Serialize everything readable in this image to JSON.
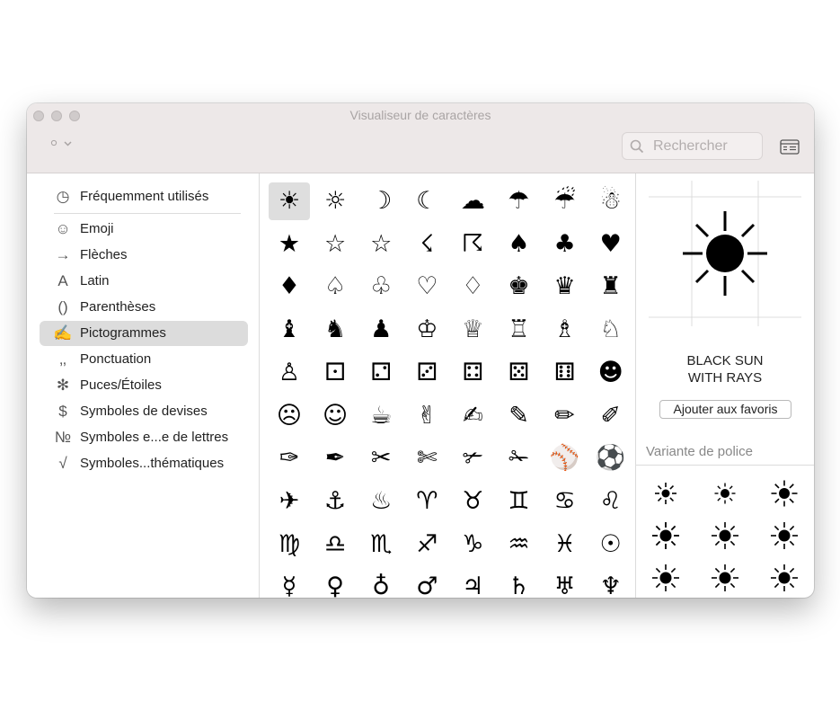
{
  "window": {
    "title": "Visualiseur de caractères"
  },
  "toolbar": {
    "view_icon": "circle-icon",
    "view_chevron": "chevron-down-icon",
    "search_placeholder": "Rechercher",
    "search_value": ""
  },
  "sidebar": {
    "items": [
      {
        "id": "frequent",
        "icon": "◷",
        "label": "Fréquemment utilisés"
      },
      {
        "id": "emoji",
        "icon": "☺",
        "label": "Emoji"
      },
      {
        "id": "arrows",
        "icon": "→",
        "label": "Flèches"
      },
      {
        "id": "latin",
        "icon": "A",
        "label": "Latin"
      },
      {
        "id": "brackets",
        "icon": "()",
        "label": "Parenthèses"
      },
      {
        "id": "pictographs",
        "icon": "✍",
        "label": "Pictogrammes",
        "selected": true
      },
      {
        "id": "punctuation",
        "icon": "‚‚",
        "label": "Ponctuation"
      },
      {
        "id": "bullets",
        "icon": "✻",
        "label": "Puces/Étoiles"
      },
      {
        "id": "currency",
        "icon": "$",
        "label": "Symboles de devises"
      },
      {
        "id": "letterlike",
        "icon": "№",
        "label": "Symboles e...e de lettres"
      },
      {
        "id": "math",
        "icon": "√",
        "label": "Symboles...thématiques"
      }
    ]
  },
  "grid": {
    "selected_index": 0,
    "chars": [
      "☀",
      "☼",
      "☽",
      "☾",
      "☁",
      "☂",
      "☔",
      "☃",
      "★",
      "☆",
      "☆",
      "☇",
      "☈",
      "♠",
      "♣",
      "♥",
      "♦",
      "♤",
      "♧",
      "♡",
      "♢",
      "♚",
      "♛",
      "♜",
      "♝",
      "♞",
      "♟",
      "♔",
      "♕",
      "♖",
      "♗",
      "♘",
      "♙",
      "⚀",
      "⚁",
      "⚂",
      "⚃",
      "⚄",
      "⚅",
      "☻",
      "☹",
      "☺",
      "☕",
      "✌",
      "✍",
      "✎",
      "✏",
      "✐",
      "✑",
      "✒",
      "✂",
      "✄",
      "✃",
      "✁",
      "⚾",
      "⚽",
      "✈",
      "⚓",
      "♨",
      "♈",
      "♉",
      "♊",
      "♋",
      "♌",
      "♍",
      "♎",
      "♏",
      "♐",
      "♑",
      "♒",
      "♓",
      "☉",
      "☿",
      "♀",
      "♁",
      "♂",
      "♃",
      "♄",
      "♅",
      "♆"
    ]
  },
  "detail": {
    "char_name_line1": "BLACK SUN",
    "char_name_line2": "WITH RAYS",
    "favorite_label": "Ajouter aux favoris",
    "variant_title": "Variante de police"
  },
  "colors": {
    "titlebar": "#ede8e8",
    "selection": "#dcdcdc"
  }
}
